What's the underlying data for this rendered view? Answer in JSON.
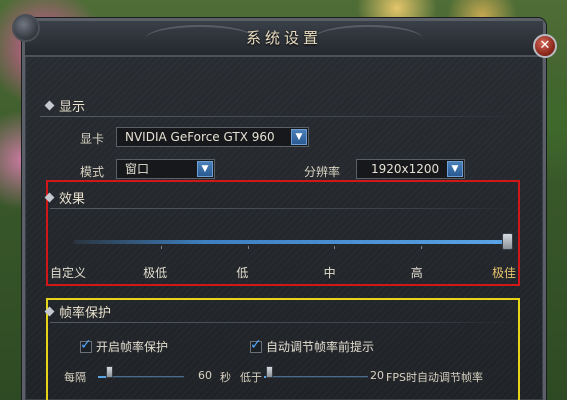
{
  "window": {
    "title": "系统设置",
    "close_glyph": "✕"
  },
  "display": {
    "header": "显示",
    "gpu_label": "显卡",
    "gpu_value": "NVIDIA GeForce GTX 960",
    "mode_label": "模式",
    "mode_value": "窗口",
    "resolution_label": "分辨率",
    "resolution_value": "1920x1200"
  },
  "effects": {
    "header": "效果",
    "levels": [
      "自定义",
      "极低",
      "低",
      "中",
      "高",
      "极佳"
    ],
    "selected_level": "极佳",
    "selected_index": 5
  },
  "frame_protection": {
    "header": "帧率保护",
    "enable_label": "开启帧率保护",
    "enable_checked": true,
    "auto_adjust_label": "自动调节帧率前提示",
    "auto_adjust_checked": true,
    "interval_prefix": "每隔",
    "interval_value": "60",
    "interval_unit": "秒",
    "threshold_prefix": "低于",
    "threshold_value": "20",
    "threshold_suffix": "FPS时自动调节帧率"
  },
  "icons": {
    "caret": "▼",
    "check": "✓"
  },
  "colors": {
    "highlight_red": "#d01818",
    "highlight_yellow": "#e6d31a",
    "accent_blue": "#3d7fc0",
    "active_level": "#e7c56c"
  }
}
